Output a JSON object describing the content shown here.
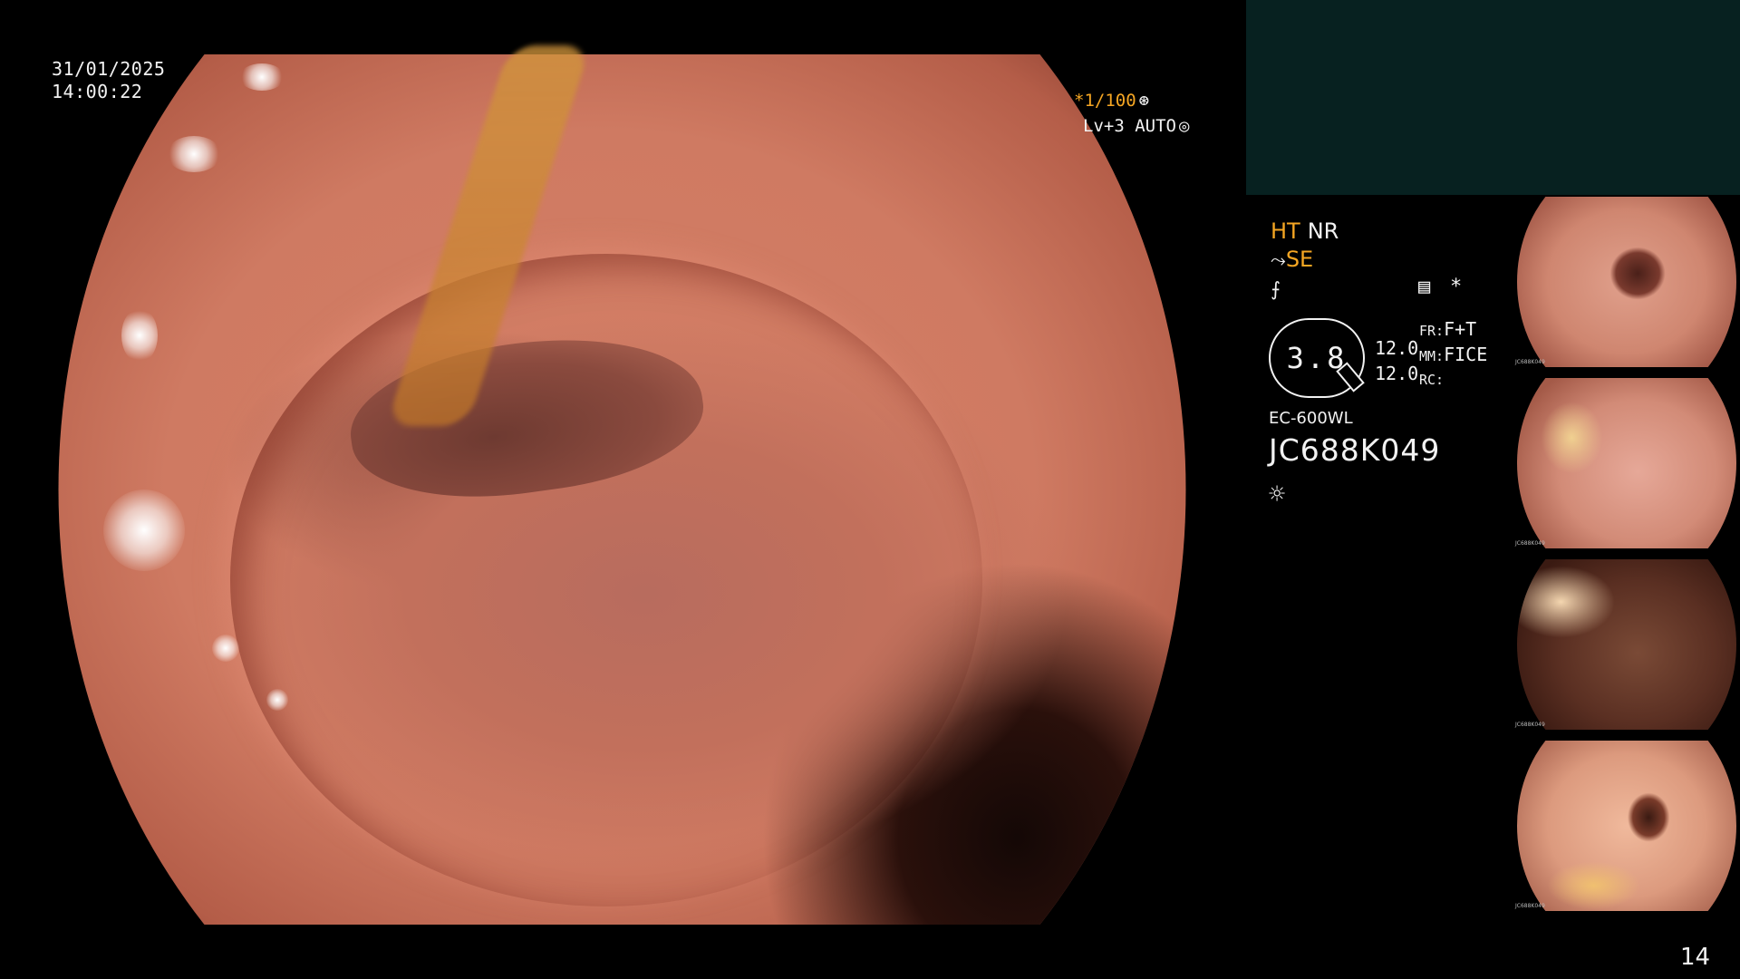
{
  "overlay": {
    "date": "31/01/2025",
    "time": "14:00:22",
    "shutter": "*1/100",
    "shutter_icon": "shutter-icon",
    "level": "Lv+3 AUTO",
    "level_icon": "iris-icon"
  },
  "modes": {
    "ht": "HT",
    "nr": "NR",
    "se_prefix": "⤳",
    "se": "SE",
    "enhance_symbol": "⨍",
    "record_icon": "memo-icon",
    "asterisk": "*"
  },
  "zoom": {
    "value": "3.8",
    "enh1": "12.0",
    "enh2": "12.0",
    "fr_label": "FR:",
    "fr_value": "F+T",
    "mm_label": "MM:",
    "mm_value": "FICE",
    "rc_label": "RC:"
  },
  "scope": {
    "model": "EC-600WL",
    "serial": "JC688K049",
    "light_icon": "sun-icon"
  },
  "thumbnails": [
    {
      "serial": "JC688K049"
    },
    {
      "serial": "JC688K049"
    },
    {
      "serial": "JC688K049"
    },
    {
      "serial": "JC688K049"
    }
  ],
  "page_number": "14",
  "colors": {
    "accent": "#f5a623",
    "panel": "#072120",
    "text": "#f2f2f2"
  }
}
